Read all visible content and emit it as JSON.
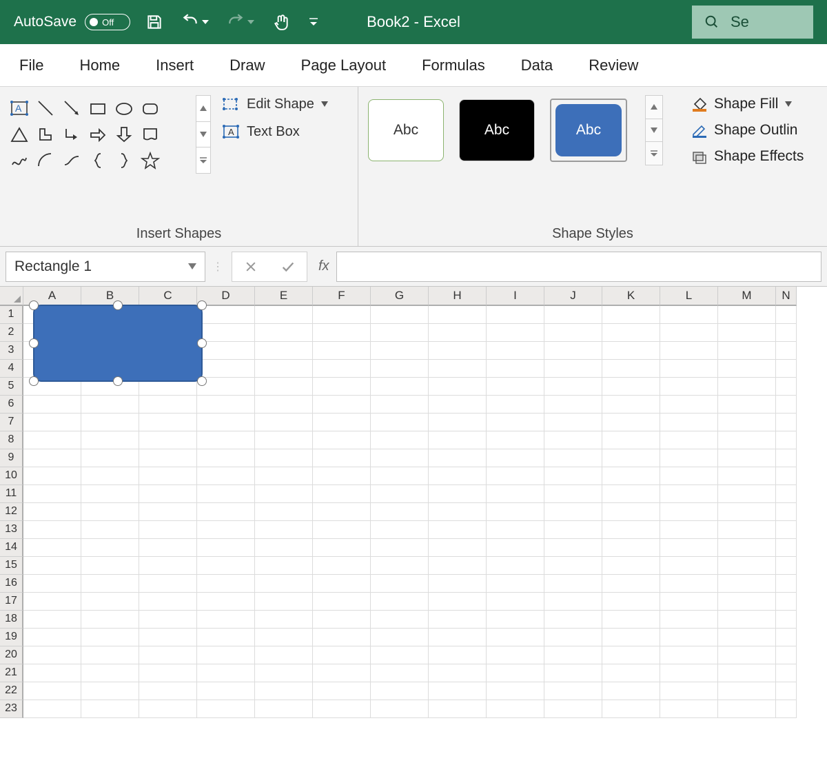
{
  "titlebar": {
    "autosave_label": "AutoSave",
    "autosave_state": "Off",
    "document_title": "Book2  -  Excel",
    "search_placeholder": "Se"
  },
  "tabs": [
    "File",
    "Home",
    "Insert",
    "Draw",
    "Page Layout",
    "Formulas",
    "Data",
    "Review"
  ],
  "ribbon": {
    "insert_shapes_group_label": "Insert Shapes",
    "edit_shape_label": "Edit Shape",
    "text_box_label": "Text Box",
    "shape_styles_group_label": "Shape Styles",
    "style_preview_text": "Abc",
    "shape_fill_label": "Shape Fill",
    "shape_outline_label": "Shape Outlin",
    "shape_effects_label": "Shape Effects"
  },
  "formula_bar": {
    "name_box_value": "Rectangle 1",
    "fx_label": "fx",
    "formula_value": ""
  },
  "grid": {
    "columns": [
      "A",
      "B",
      "C",
      "D",
      "E",
      "F",
      "G",
      "H",
      "I",
      "J",
      "K",
      "L",
      "M",
      "N"
    ],
    "rows": [
      1,
      2,
      3,
      4,
      5,
      6,
      7,
      8,
      9,
      10,
      11,
      12,
      13,
      14,
      15,
      16,
      17,
      18,
      19,
      20,
      21,
      22,
      23
    ]
  },
  "selected_shape": {
    "name": "Rectangle 1",
    "type": "rounded-rectangle",
    "fill": "#3d6fb9"
  }
}
